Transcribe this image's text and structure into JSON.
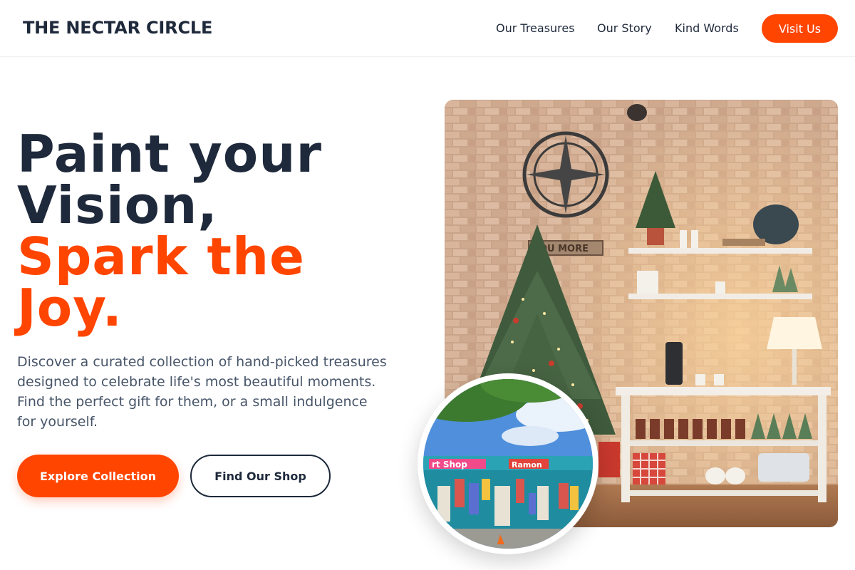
{
  "brand": {
    "name": "THE NECTAR CIRCLE"
  },
  "nav": {
    "links": [
      "Our Treasures",
      "Our Story",
      "Kind Words"
    ],
    "cta": "Visit Us"
  },
  "hero": {
    "title_line1": "Paint your",
    "title_line2": "Vision,",
    "title_line3": "Spark the",
    "title_line4": "Joy.",
    "description": "Discover a curated collection of hand-picked treasures designed to celebrate life's most beautiful moments. Find the perfect gift for them, or a small indulgence for yourself.",
    "primary_button": "Explore Collection",
    "secondary_button": "Find Our Shop"
  },
  "images": {
    "main_sign": "YOU MORE",
    "badge_sign_left": "rt Shop",
    "badge_sign_right": "Ramon"
  },
  "colors": {
    "accent": "#ff4500",
    "dark": "#1e293b",
    "muted": "#475569"
  }
}
